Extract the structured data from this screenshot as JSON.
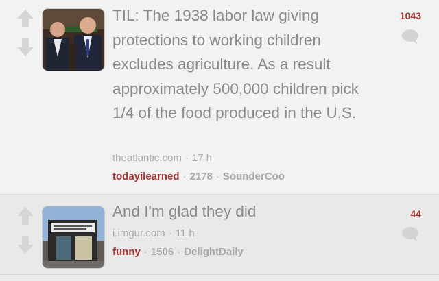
{
  "posts": [
    {
      "title": "TIL: The 1938 labor law giving protections to working children excludes agriculture. As a result approximately 500,000 children pick 1/4 of the food produced in the U.S.",
      "domain": "theatlantic.com",
      "age": "17 h",
      "subreddit": "todayilearned",
      "comments": "2178",
      "author": "SounderCoo",
      "score": "1043",
      "thumbnail_icon": "thumbnail-image"
    },
    {
      "title": "And I'm glad they did",
      "domain": "i.imgur.com",
      "age": "11 h",
      "subreddit": "funny",
      "comments": "1506",
      "author": "DelightDaily",
      "score": "44",
      "thumbnail_icon": "thumbnail-image"
    }
  ],
  "colors": {
    "accent": "#a4312f",
    "title": "#8a8a8a",
    "meta": "#a8a8a8",
    "icon": "#d3d3d3"
  }
}
